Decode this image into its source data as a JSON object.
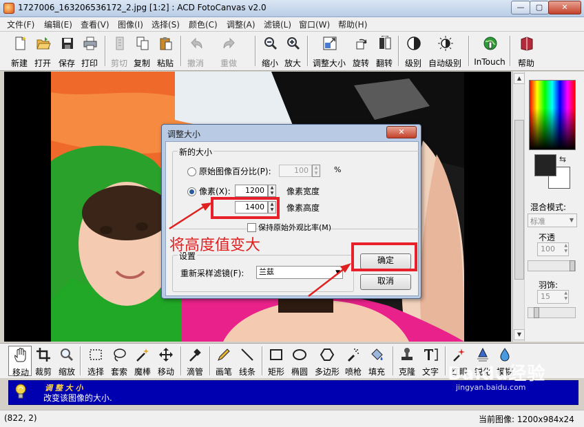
{
  "window": {
    "title": "1727006_163206536172_2.jpg [1:2] : ACD FotoCanvas v2.0",
    "minimize_icon": "minimize-icon",
    "maximize_icon": "maximize-icon",
    "close_icon": "close-icon"
  },
  "menu": [
    "文件(F)",
    "编辑(E)",
    "查看(V)",
    "图像(I)",
    "选择(S)",
    "颜色(C)",
    "调整(A)",
    "滤镜(L)",
    "窗口(W)",
    "帮助(H)"
  ],
  "toolbar": [
    {
      "label": "新建",
      "icon": "new-file-icon",
      "enabled": true
    },
    {
      "label": "打开",
      "icon": "open-folder-icon",
      "enabled": true
    },
    {
      "label": "保存",
      "icon": "save-icon",
      "enabled": true
    },
    {
      "label": "打印",
      "icon": "print-icon",
      "enabled": true
    },
    {
      "label": "剪切",
      "icon": "cut-icon",
      "enabled": false
    },
    {
      "label": "复制",
      "icon": "copy-icon",
      "enabled": true
    },
    {
      "label": "粘贴",
      "icon": "paste-icon",
      "enabled": true
    },
    {
      "label": "撤消",
      "icon": "undo-icon",
      "enabled": false
    },
    {
      "label": "重做",
      "icon": "redo-icon",
      "enabled": false
    },
    {
      "label": "缩小",
      "icon": "zoom-out-icon",
      "enabled": true
    },
    {
      "label": "放大",
      "icon": "zoom-in-icon",
      "enabled": true
    },
    {
      "label": "调整大小",
      "icon": "resize-icon",
      "enabled": true
    },
    {
      "label": "旋转",
      "icon": "rotate-icon",
      "enabled": true
    },
    {
      "label": "翻转",
      "icon": "flip-icon",
      "enabled": true
    },
    {
      "label": "级别",
      "icon": "levels-icon",
      "enabled": true
    },
    {
      "label": "自动级别",
      "icon": "auto-levels-icon",
      "enabled": true
    },
    {
      "label": "InTouch",
      "icon": "intouch-globe-icon",
      "enabled": true
    },
    {
      "label": "帮助",
      "icon": "help-book-icon",
      "enabled": true
    }
  ],
  "tools": [
    {
      "label": "移动",
      "icon": "hand-icon",
      "active": true
    },
    {
      "label": "裁剪",
      "icon": "crop-icon",
      "active": false
    },
    {
      "label": "缩放",
      "icon": "magnifier-icon",
      "active": false
    },
    {
      "label": "选择",
      "icon": "rect-select-icon",
      "active": false
    },
    {
      "label": "套索",
      "icon": "lasso-icon",
      "active": false
    },
    {
      "label": "魔棒",
      "icon": "magic-wand-icon",
      "active": false
    },
    {
      "label": "移动",
      "icon": "move-arrows-icon",
      "active": false
    },
    {
      "label": "滴管",
      "icon": "eyedropper-icon",
      "active": false
    },
    {
      "label": "画笔",
      "icon": "pencil-icon",
      "active": false
    },
    {
      "label": "线条",
      "icon": "line-icon",
      "active": false
    },
    {
      "label": "矩形",
      "icon": "rectangle-icon",
      "active": false
    },
    {
      "label": "椭圆",
      "icon": "ellipse-icon",
      "active": false
    },
    {
      "label": "多边形",
      "icon": "polygon-icon",
      "active": false
    },
    {
      "label": "喷枪",
      "icon": "airbrush-icon",
      "active": false
    },
    {
      "label": "填充",
      "icon": "paint-bucket-icon",
      "active": false
    },
    {
      "label": "克隆",
      "icon": "clone-stamp-icon",
      "active": false
    },
    {
      "label": "文字",
      "icon": "text-tool-icon",
      "active": false
    },
    {
      "label": "红眼",
      "icon": "red-eye-icon",
      "active": false
    },
    {
      "label": "锐化",
      "icon": "sharpen-icon",
      "active": false
    },
    {
      "label": "模糊",
      "icon": "blur-drop-icon",
      "active": false
    }
  ],
  "right_panel": {
    "blend_label": "混合模式:",
    "blend_value": "标准",
    "opacity_label": "不透",
    "opacity_value": "100",
    "feather_label": "羽饰:",
    "feather_value": "15",
    "swap_icon": "swap-colors-icon",
    "foreground_color": "#232323",
    "background_color": "#ffffff"
  },
  "hint": {
    "title": "调 整 大 小",
    "desc": "改变该图像的大小.",
    "icon": "lightbulb-icon"
  },
  "status": {
    "coords": "(822, 2)",
    "image_info": "当前图像: 1200x984x24"
  },
  "dialog": {
    "title": "调整大小",
    "group_new_size": "新的大小",
    "percent_label": "原始图像百分比(P):",
    "percent_value": "100",
    "percent_unit": "%",
    "pixels_label": "像素(X):",
    "width_value": "1200",
    "width_label": "像素宽度",
    "height_value": "1400",
    "height_label": "像素高度",
    "keep_ratio_label": "保持原始外观比率(M)",
    "group_settings": "设置",
    "filter_label": "重新采样滤镜(F):",
    "filter_value": "兰兹",
    "ok_label": "确定",
    "cancel_label": "取消"
  },
  "annotation": {
    "text": "将高度值变大",
    "color": "#e02020"
  },
  "watermark": {
    "text": "Baidu经验",
    "url": "jingyan.baidu.com"
  }
}
